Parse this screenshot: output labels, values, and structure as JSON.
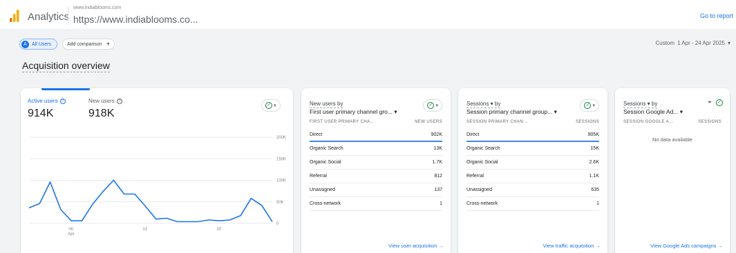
{
  "header": {
    "app_name": "Analytics",
    "account_domain": "www.indiablooms.com",
    "account_url": "https://www.indiablooms.co...",
    "go_to_report": "Go to report"
  },
  "toolbar": {
    "segment_avatar": "A",
    "segment_label": "All Users",
    "add_comparison": "Add comparison",
    "add_icon": "+",
    "date_prefix": "Custom",
    "date_range": "1 Apr - 24 Apr 2025",
    "date_caret": "▾"
  },
  "page_title": "Acquisition overview",
  "users_card": {
    "metrics": [
      {
        "label": "Active users",
        "value": "914K"
      },
      {
        "label": "New users",
        "value": "918K"
      }
    ],
    "help_glyph": "?",
    "check_glyph": "✓",
    "caret": "▾"
  },
  "chart_data": {
    "type": "line",
    "series": [
      {
        "values": [
          36,
          46,
          96,
          32,
          6,
          6,
          44,
          74,
          100,
          68,
          68,
          40,
          10,
          12,
          4,
          4,
          4,
          8,
          6,
          8,
          18,
          58,
          42,
          4
        ]
      }
    ],
    "x_tick_labels": [
      {
        "index": 4,
        "label": "06",
        "sublabel": "Apr"
      },
      {
        "index": 11,
        "label": "13"
      },
      {
        "index": 18,
        "label": "20"
      }
    ],
    "y_tick_labels": [
      "200K",
      "150K",
      "100K",
      "50K",
      "0"
    ],
    "ylim": [
      0,
      200
    ],
    "series_color": "#1a73e8"
  },
  "new_users_card": {
    "heading_line1": "New users by",
    "heading_line2": "First user primary channel gro...",
    "caret": "▾",
    "col_left": "FIRST USER PRIMARY CHA...",
    "col_right": "NEW USERS",
    "rows": [
      {
        "name": "Direct",
        "value": "902K"
      },
      {
        "name": "Organic Search",
        "value": "13K"
      },
      {
        "name": "Organic Social",
        "value": "1.7K"
      },
      {
        "name": "Referral",
        "value": "812"
      },
      {
        "name": "Unassigned",
        "value": "137"
      },
      {
        "name": "Cross-network",
        "value": "1"
      }
    ],
    "footer_link": "View user acquisition  →"
  },
  "sessions_card": {
    "heading_line1": "Sessions ▾ by",
    "heading_line2": "Session primary channel group...",
    "caret": "▾",
    "col_left": "SESSION PRIMARY CHAN...",
    "col_right": "SESSIONS",
    "rows": [
      {
        "name": "Direct",
        "value": "905K"
      },
      {
        "name": "Organic Search",
        "value": "15K"
      },
      {
        "name": "Organic Social",
        "value": "2.6K"
      },
      {
        "name": "Referral",
        "value": "1.1K"
      },
      {
        "name": "Unassigned",
        "value": "635"
      },
      {
        "name": "Cross-network",
        "value": "1"
      }
    ],
    "footer_link": "View traffic acquisition  →"
  },
  "ads_card": {
    "heading_line1": "Sessions ▾ by",
    "heading_line2": "Session Google Ad...",
    "caret": "▾",
    "filter_glyph": "⏷",
    "col_left": "SESSION GOOGLE A...",
    "col_right": "SESSIONS",
    "no_data": "No data available",
    "footer_link": "View Google Ads campaigns  →"
  },
  "colors": {
    "accent": "#1a73e8",
    "check_green": "#188038",
    "logo_orange": "#f9ab00",
    "logo_dark": "#e37400"
  }
}
